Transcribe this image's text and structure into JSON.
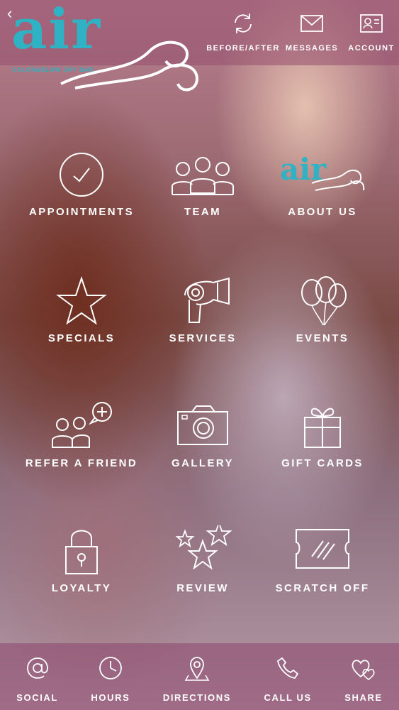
{
  "header": {
    "back_icon": "chevron-left-icon",
    "logo_text": "air",
    "logo_tagline": "SALON&BLOW DRY BAR",
    "actions": [
      {
        "label": "BEFORE/AFTER",
        "icon": "refresh-icon"
      },
      {
        "label": "MESSAGES",
        "icon": "envelope-icon"
      },
      {
        "label": "ACCOUNT",
        "icon": "id-card-icon"
      }
    ]
  },
  "menu": [
    {
      "label": "APPOINTMENTS",
      "icon": "check-circle-icon"
    },
    {
      "label": "TEAM",
      "icon": "people-icon"
    },
    {
      "label": "ABOUT US",
      "icon": "air-logo-icon",
      "logo_text": "air"
    },
    {
      "label": "SPECIALS",
      "icon": "star-icon"
    },
    {
      "label": "SERVICES",
      "icon": "hair-dryer-icon"
    },
    {
      "label": "EVENTS",
      "icon": "balloons-icon"
    },
    {
      "label": "REFER A FRIEND",
      "icon": "refer-friend-icon"
    },
    {
      "label": "GALLERY",
      "icon": "camera-icon"
    },
    {
      "label": "GIFT CARDS",
      "icon": "gift-icon"
    },
    {
      "label": "LOYALTY",
      "icon": "lock-icon"
    },
    {
      "label": "REVIEW",
      "icon": "stars-icon"
    },
    {
      "label": "SCRATCH OFF",
      "icon": "ticket-icon"
    }
  ],
  "footer": [
    {
      "label": "SOCIAL",
      "icon": "at-icon"
    },
    {
      "label": "HOURS",
      "icon": "clock-icon"
    },
    {
      "label": "DIRECTIONS",
      "icon": "map-pin-icon"
    },
    {
      "label": "CALL US",
      "icon": "phone-icon"
    },
    {
      "label": "SHARE",
      "icon": "hearts-icon"
    }
  ],
  "colors": {
    "brand": "#2fb3c4",
    "text": "#ffffff"
  }
}
